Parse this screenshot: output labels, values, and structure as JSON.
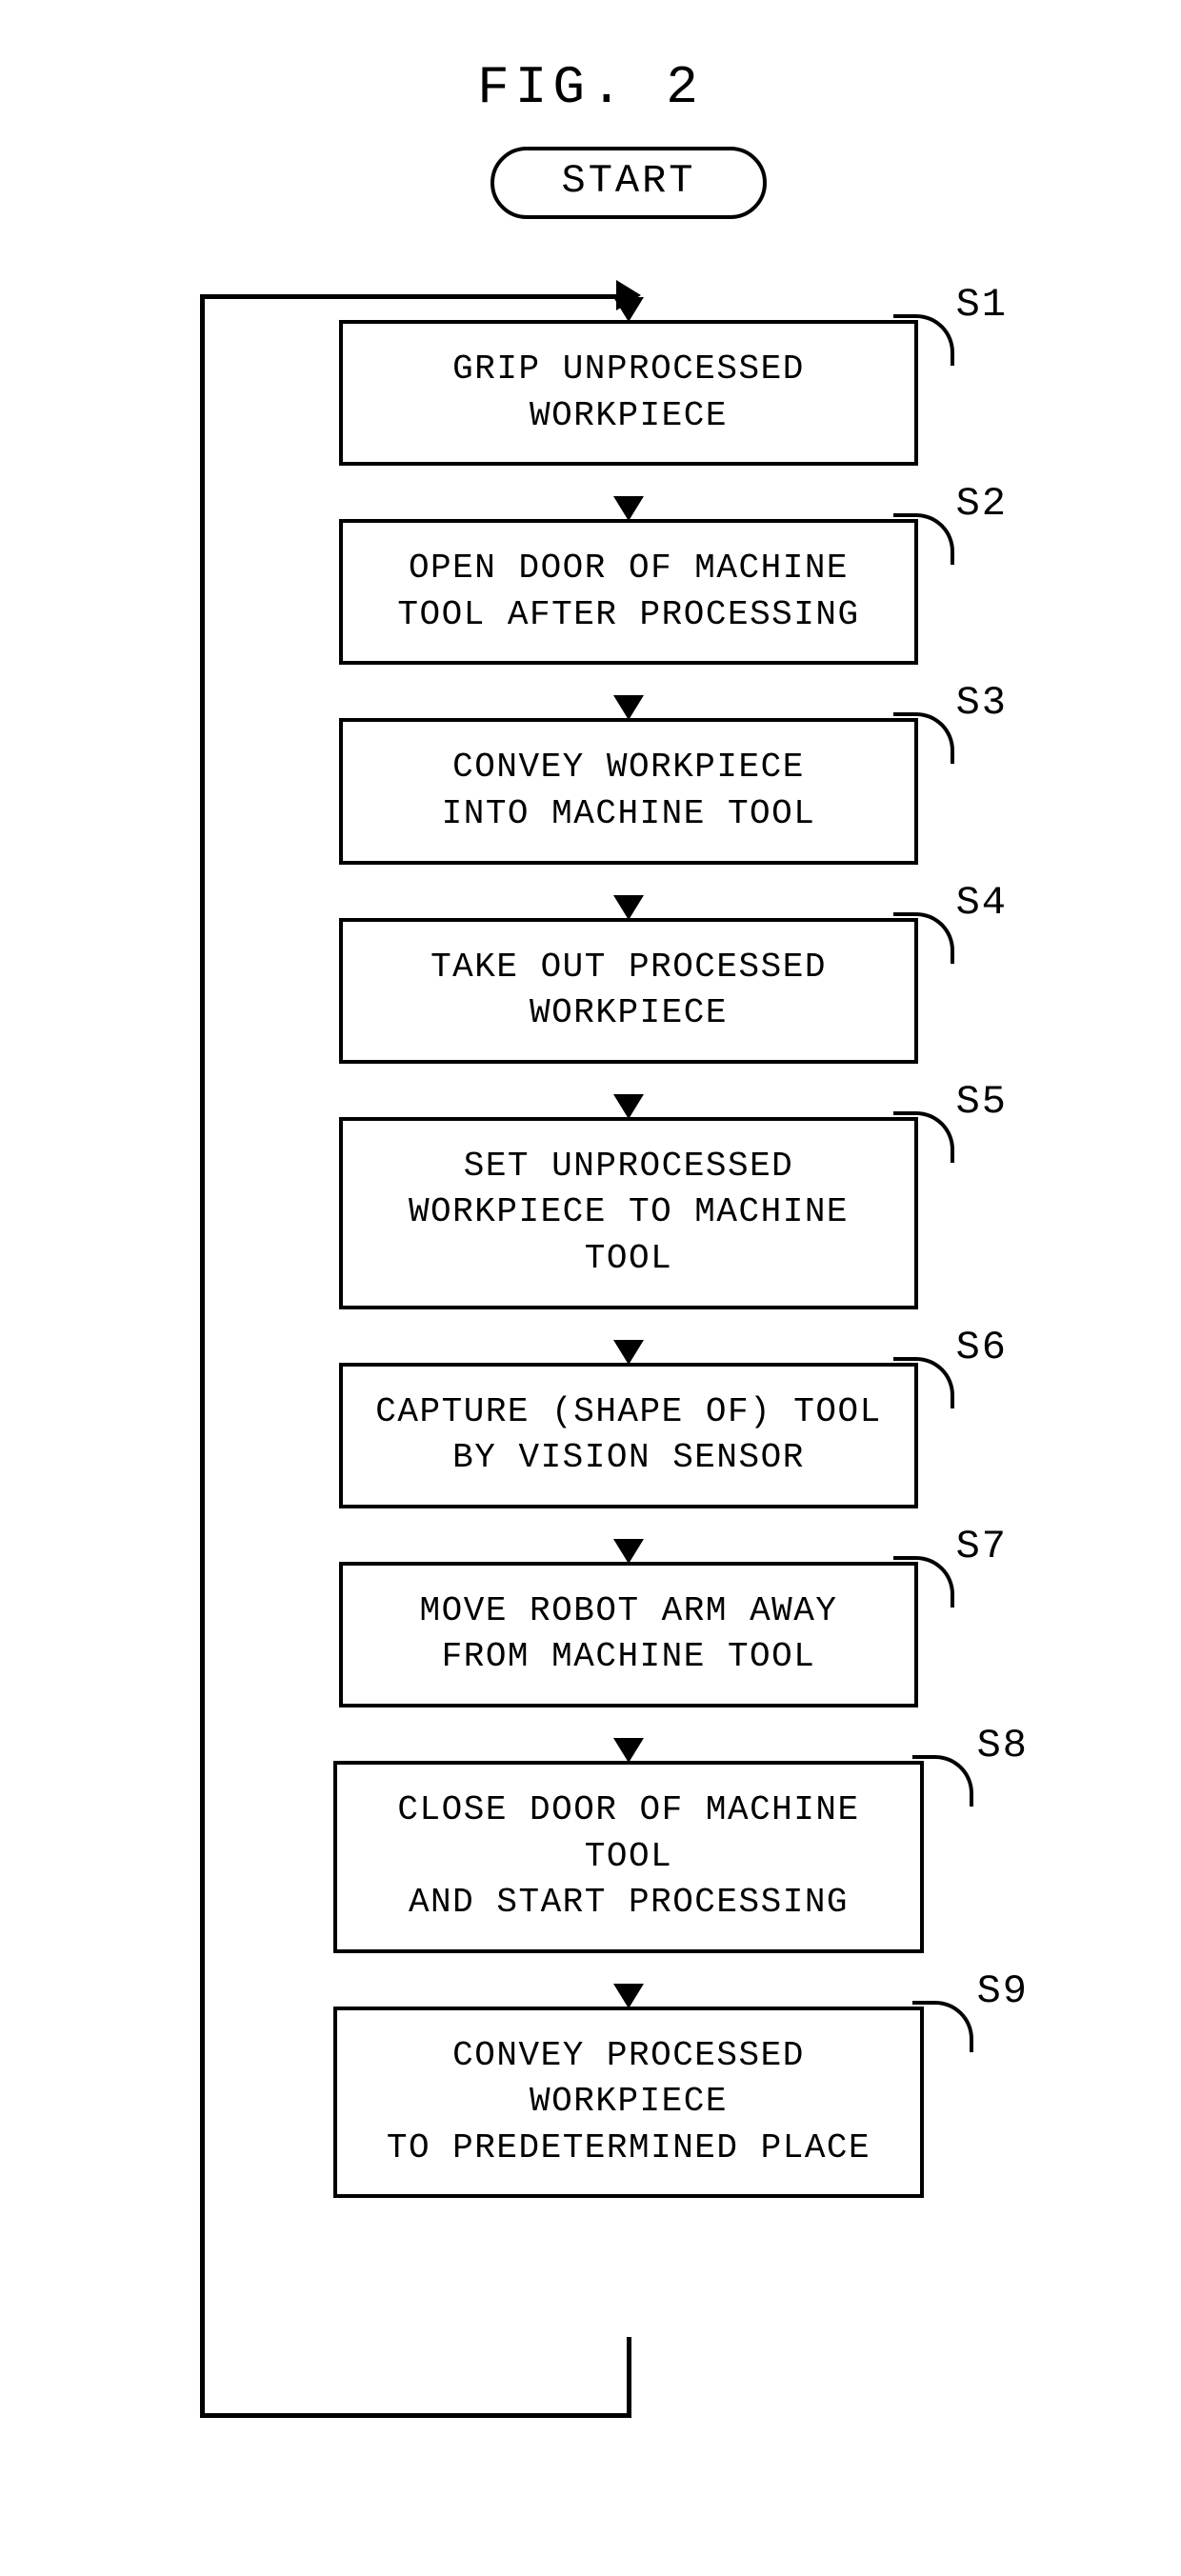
{
  "figure_title": "FIG. 2",
  "start_label": "START",
  "steps": [
    {
      "id": "S1",
      "text": "GRIP UNPROCESSED WORKPIECE"
    },
    {
      "id": "S2",
      "text": "OPEN DOOR OF MACHINE\nTOOL AFTER PROCESSING"
    },
    {
      "id": "S3",
      "text": "CONVEY WORKPIECE\nINTO MACHINE TOOL"
    },
    {
      "id": "S4",
      "text": "TAKE OUT PROCESSED\nWORKPIECE"
    },
    {
      "id": "S5",
      "text": "SET UNPROCESSED\nWORKPIECE TO MACHINE TOOL"
    },
    {
      "id": "S6",
      "text": "CAPTURE (SHAPE OF) TOOL\nBY VISION SENSOR"
    },
    {
      "id": "S7",
      "text": "MOVE ROBOT ARM AWAY\nFROM MACHINE TOOL"
    },
    {
      "id": "S8",
      "text": "CLOSE DOOR OF MACHINE TOOL\nAND START PROCESSING"
    },
    {
      "id": "S9",
      "text": "CONVEY PROCESSED WORKPIECE\nTO PREDETERMINED PLACE"
    }
  ],
  "chart_data": {
    "type": "flowchart",
    "title": "FIG. 2",
    "nodes": [
      {
        "id": "start",
        "kind": "terminator",
        "label": "START"
      },
      {
        "id": "S1",
        "kind": "process",
        "label": "GRIP UNPROCESSED WORKPIECE"
      },
      {
        "id": "S2",
        "kind": "process",
        "label": "OPEN DOOR OF MACHINE TOOL AFTER PROCESSING"
      },
      {
        "id": "S3",
        "kind": "process",
        "label": "CONVEY WORKPIECE INTO MACHINE TOOL"
      },
      {
        "id": "S4",
        "kind": "process",
        "label": "TAKE OUT PROCESSED WORKPIECE"
      },
      {
        "id": "S5",
        "kind": "process",
        "label": "SET UNPROCESSED WORKPIECE TO MACHINE TOOL"
      },
      {
        "id": "S6",
        "kind": "process",
        "label": "CAPTURE (SHAPE OF) TOOL BY VISION SENSOR"
      },
      {
        "id": "S7",
        "kind": "process",
        "label": "MOVE ROBOT ARM AWAY FROM MACHINE TOOL"
      },
      {
        "id": "S8",
        "kind": "process",
        "label": "CLOSE DOOR OF MACHINE TOOL AND START PROCESSING"
      },
      {
        "id": "S9",
        "kind": "process",
        "label": "CONVEY PROCESSED WORKPIECE TO PREDETERMINED PLACE"
      }
    ],
    "edges": [
      {
        "from": "start",
        "to": "S1"
      },
      {
        "from": "S1",
        "to": "S2"
      },
      {
        "from": "S2",
        "to": "S3"
      },
      {
        "from": "S3",
        "to": "S4"
      },
      {
        "from": "S4",
        "to": "S5"
      },
      {
        "from": "S5",
        "to": "S6"
      },
      {
        "from": "S6",
        "to": "S7"
      },
      {
        "from": "S7",
        "to": "S8"
      },
      {
        "from": "S8",
        "to": "S9"
      },
      {
        "from": "S9",
        "to": "S1",
        "kind": "loop-back"
      }
    ]
  }
}
